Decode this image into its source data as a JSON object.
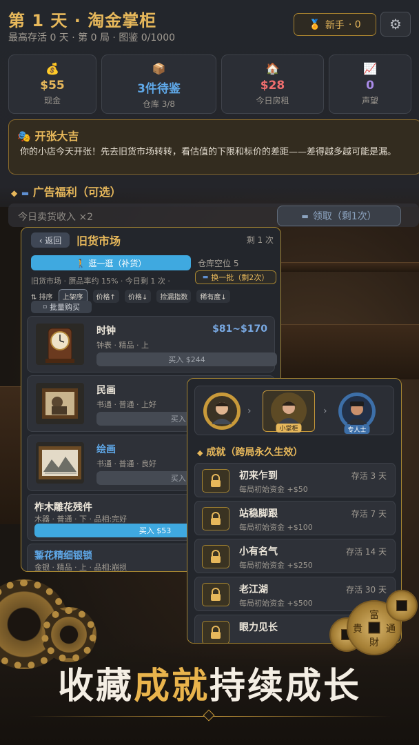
{
  "header": {
    "title": "第 1 天 · 淘金掌柜",
    "subtitle": "最高存活 0 天 · 第 0 局 · 图鉴 0/1000",
    "rank_label": "新手",
    "rank_points": "· 0",
    "rank_icon": "medal-icon",
    "settings_icon": "gear-icon"
  },
  "stats": [
    {
      "icon": "money-bag-icon",
      "value": "$55",
      "label": "现金",
      "color": "#e7b85b"
    },
    {
      "icon": "box-icon",
      "value": "3件待鉴",
      "label": "仓库 3/8",
      "color": "#5fa8e8"
    },
    {
      "icon": "house-icon",
      "value": "$28",
      "label": "今日房租",
      "color": "#ef6e6e"
    },
    {
      "icon": "chart-icon",
      "value": "0",
      "label": "声望",
      "color": "#a98be8"
    }
  ],
  "notice": {
    "title": "开张大吉",
    "body": "你的小店今天开张！先去旧货市场转转，看估值的下限和标价的差距——差得越多越可能是漏。"
  },
  "ad": {
    "heading": "广告福利（可选）",
    "row_text": "今日卖货收入 ×2",
    "claim_label": "领取（剩1次）"
  },
  "market": {
    "back_label": "‹ 返回",
    "title": "旧货市场",
    "remaining": "剩 1 次",
    "stroll_label": "🚶 逛一逛（补货）",
    "space_label": "仓库空位 5",
    "meta": "旧货市场 · 赝品率约 15% · 今日剩 1 次 ·",
    "swap_label": "换一批（剩2次）",
    "sort_label": "⇅ 排序",
    "sort_options": [
      "上架序",
      "价格↑",
      "价格↓",
      "捡漏指数",
      "稀有度↓"
    ],
    "batch_label": "批量购买",
    "items": [
      {
        "name": "时钟",
        "price": "$81~$170",
        "meta": "钟表 · 精品 · 上",
        "buy": "买入 $244"
      },
      {
        "name": "民画",
        "price": "",
        "meta": "书通 · 普通 · 上好",
        "buy": "买入 $64"
      },
      {
        "name": "绘画",
        "price": "",
        "meta": "书通 · 普通 · 良好",
        "buy": "买入 $41"
      },
      {
        "name": "柞木雕花残件",
        "price": "",
        "meta": "木器 · 普通 · 下 · 品相:完好",
        "buy": "买入 $53"
      },
      {
        "name": "錾花精细银锁",
        "price": "",
        "meta": "金银 · 精品 · 上 · 品相:崩损",
        "buy": ""
      }
    ]
  },
  "achievements": {
    "ranks": [
      {
        "tag": ""
      },
      {
        "tag": "小掌柜"
      },
      {
        "tag": "专人士"
      }
    ],
    "heading": "成就（跨局永久生效）",
    "list": [
      {
        "name": "初来乍到",
        "desc": "每局初始资金 +$50",
        "days": "存活 3 天"
      },
      {
        "name": "站稳脚跟",
        "desc": "每局初始资金 +$100",
        "days": "存活 7 天"
      },
      {
        "name": "小有名气",
        "desc": "每局初始资金 +$250",
        "days": "存活 14 天"
      },
      {
        "name": "老江湖",
        "desc": "每局初始资金 +$500",
        "days": "存活 30 天"
      },
      {
        "name": "眼力见长",
        "desc": "",
        "days": ""
      }
    ]
  },
  "slogan": {
    "part1": "收藏",
    "part2": "成就",
    "part3": "持续",
    "part4": "成长"
  },
  "coin_text": "富貴通財"
}
